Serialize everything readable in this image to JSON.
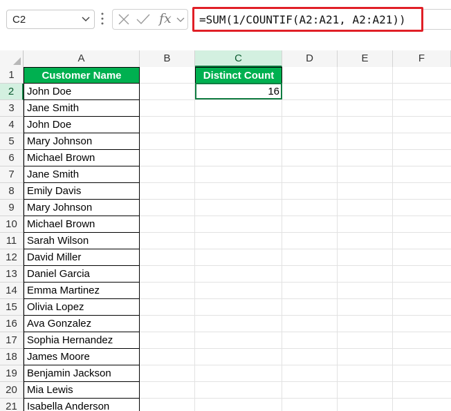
{
  "formula_bar": {
    "name_box": "C2",
    "fx_label": "fx",
    "formula": "=SUM(1/COUNTIF(A2:A21, A2:A21))"
  },
  "columns": [
    "A",
    "B",
    "C",
    "D",
    "E",
    "F"
  ],
  "rows": [
    "1",
    "2",
    "3",
    "4",
    "5",
    "6",
    "7",
    "8",
    "9",
    "10",
    "11",
    "12",
    "13",
    "14",
    "15",
    "16",
    "17",
    "18",
    "19",
    "20",
    "21"
  ],
  "sheet": {
    "header_a": "Customer Name",
    "header_c": "Distinct Count",
    "distinct_value": "16",
    "names": [
      "John Doe",
      "Jane Smith",
      "John Doe",
      "Mary Johnson",
      "Michael Brown",
      "Jane Smith",
      "Emily Davis",
      "Mary Johnson",
      "Michael Brown",
      "Sarah Wilson",
      "David Miller",
      "Daniel Garcia",
      "Emma Martinez",
      "Olivia Lopez",
      "Ava Gonzalez",
      "Sophia Hernandez",
      "James Moore",
      "Benjamin Jackson",
      "Mia Lewis",
      "Isabella Anderson"
    ]
  },
  "colors": {
    "header_fill": "#00b050",
    "formula_highlight": "#e01f26",
    "selection": "#107c41"
  }
}
